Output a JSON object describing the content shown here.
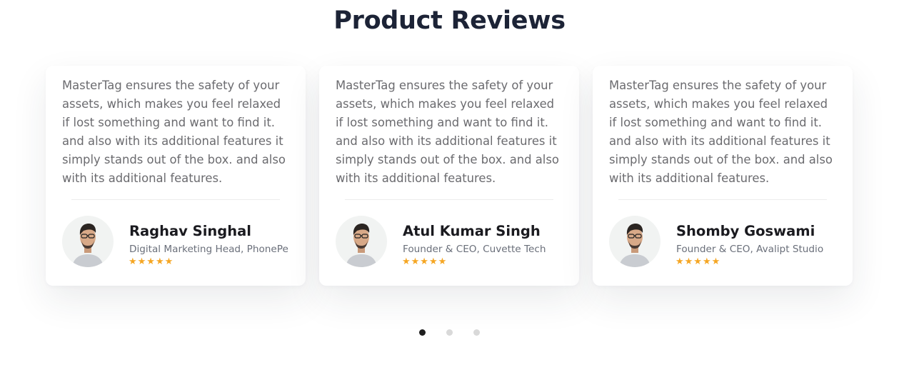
{
  "title": "Product Reviews",
  "colors": {
    "star": "#f5a623",
    "title": "#1c2336",
    "dot_active": "#1f1f1f",
    "dot_inactive": "#d9d9d9"
  },
  "reviews": [
    {
      "text": "MasterTag ensures the safety of your assets, which makes you feel relaxed if lost something and want to find it. and also with its additional features it simply stands out of the box. and also with its additional features.",
      "name": "Raghav Singhal",
      "role": "Digital Marketing Head, PhonePe",
      "stars": "★★★★★",
      "rating": 5
    },
    {
      "text": "MasterTag ensures the safety of your assets, which makes you feel relaxed if lost something and want to find it. and also with its additional features it simply stands out of the box. and also with its additional features.",
      "name": "Atul Kumar Singh",
      "role": "Founder & CEO, Cuvette Tech",
      "stars": "★★★★★",
      "rating": 5
    },
    {
      "text": "MasterTag ensures the safety of your assets, which makes you feel relaxed if lost something and want to find it. and also with its additional features it simply stands out of the box. and also with its additional features.",
      "name": "Shomby Goswami",
      "role": "Founder & CEO, Avalipt Studio",
      "stars": "★★★★★",
      "rating": 5
    }
  ],
  "pagination": {
    "pages": 3,
    "active": 1
  }
}
